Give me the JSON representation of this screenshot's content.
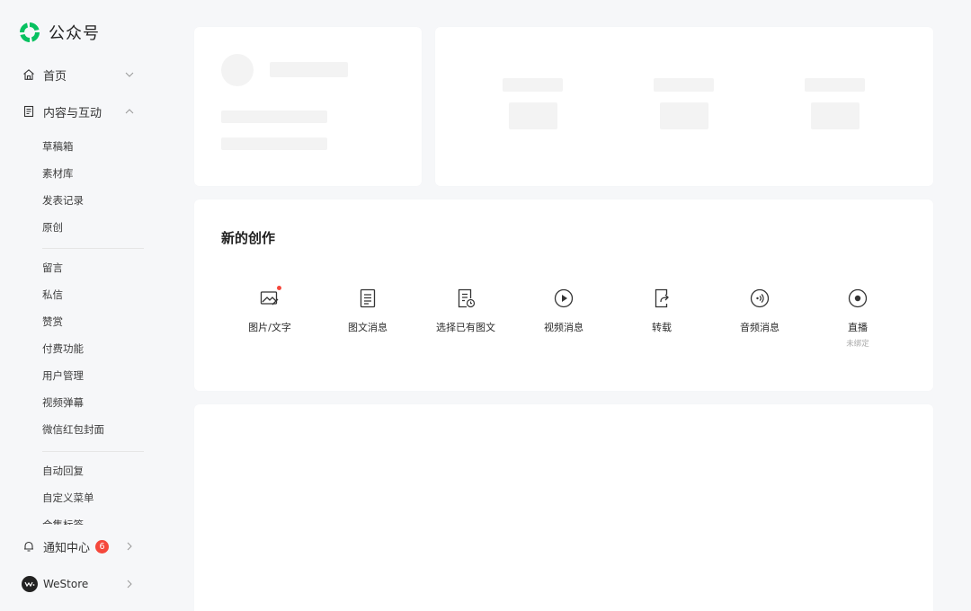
{
  "brand": {
    "name": "公众号",
    "accent": "#07c160"
  },
  "nav": {
    "home": {
      "label": "首页",
      "icon": "home-icon"
    },
    "content": {
      "label": "内容与互动",
      "icon": "document-icon",
      "groups": [
        [
          "草稿箱",
          "素材库",
          "发表记录",
          "原创"
        ],
        [
          "留言",
          "私信",
          "赞赏",
          "付费功能",
          "用户管理",
          "视频弹幕",
          "微信红包封面"
        ],
        [
          "自动回复",
          "自定义菜单",
          "合集标签"
        ]
      ]
    },
    "notifications": {
      "label": "通知中心",
      "count": "6",
      "icon": "bell-icon"
    },
    "westore": {
      "label": "WeStore"
    }
  },
  "creation": {
    "title": "新的创作",
    "tools": [
      {
        "label": "图片/文字",
        "icon": "image-text-icon",
        "sub": "",
        "dot": true
      },
      {
        "label": "图文消息",
        "icon": "article-icon",
        "sub": ""
      },
      {
        "label": "选择已有图文",
        "icon": "existing-article-icon",
        "sub": ""
      },
      {
        "label": "视频消息",
        "icon": "video-icon",
        "sub": ""
      },
      {
        "label": "转载",
        "icon": "repost-icon",
        "sub": ""
      },
      {
        "label": "音频消息",
        "icon": "audio-icon",
        "sub": ""
      },
      {
        "label": "直播",
        "icon": "live-icon",
        "sub": "未绑定"
      }
    ]
  }
}
